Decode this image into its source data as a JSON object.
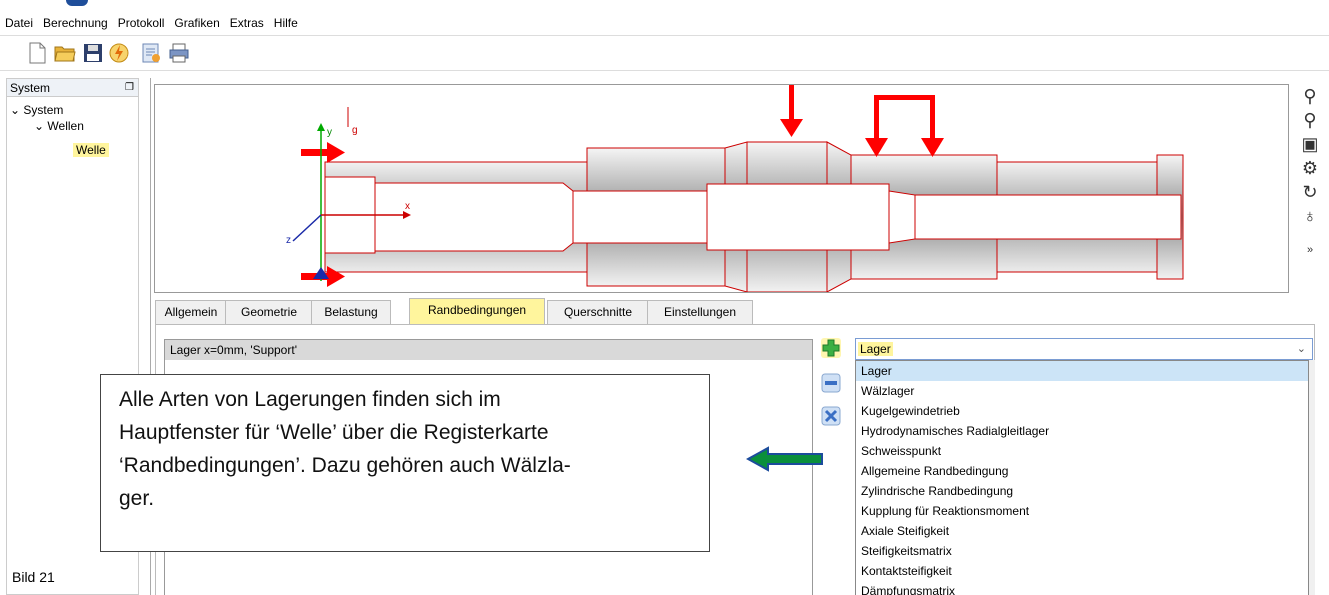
{
  "menu": [
    "Datei",
    "Berechnung",
    "Protokoll",
    "Grafiken",
    "Extras",
    "Hilfe"
  ],
  "toolbar_icons": [
    "new-file-icon",
    "open-folder-icon",
    "save-icon",
    "calculate-icon",
    "report-icon",
    "print-icon"
  ],
  "panel": {
    "title": "System"
  },
  "tree": {
    "root": "System",
    "group": "Wellen",
    "item": "Welle"
  },
  "canvas_axes": {
    "y": "y",
    "g": "g",
    "x": "x",
    "z": "z"
  },
  "tabs": [
    "Allgemein",
    "Geometrie",
    "Belastung",
    "Randbedingungen",
    "Querschnitte",
    "Einstellungen"
  ],
  "active_tab": "Randbedingungen",
  "conditions": [
    "Lager x=0mm, 'Support'"
  ],
  "dropdown": {
    "selected": "Lager"
  },
  "options": [
    "Lager",
    "Wälzlager",
    "Kugelgewindetrieb",
    "Hydrodynamisches Radialgleitlager",
    "Schweisspunkt",
    "Allgemeine Randbedingung",
    "Zylindrische Randbedingung",
    "Kupplung für Reaktionsmoment",
    "Axiale Steifigkeit",
    "Steifigkeitsmatrix",
    "Kontaktsteifigkeit",
    "Dämpfungsmatrix"
  ],
  "callout": {
    "lines": [
      "Alle Arten von Lagerungen finden sich im",
      "Hauptfenster für ‘Welle’ über die Registerkarte",
      "‘Randbedingungen’. Dazu gehören auch Wälzla-",
      "ger."
    ]
  },
  "caption": "Bild 21",
  "colors": {
    "highlight": "#fff59d",
    "load_arrow": "#ff0000",
    "add": "#3cb043",
    "arrow_callout": "#0a8f3c"
  }
}
